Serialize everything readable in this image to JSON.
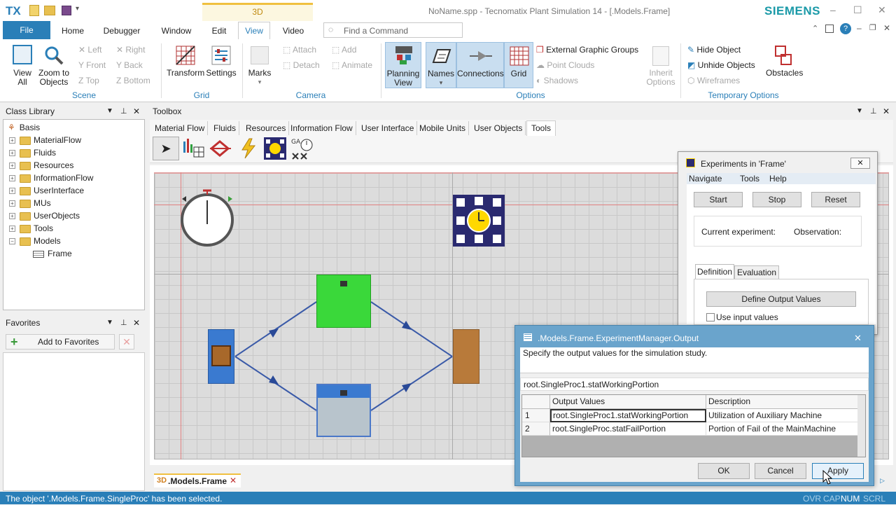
{
  "titlebar": {
    "logo": "TX",
    "context_tab": "3D",
    "title": "NoName.spp - Tecnomatix Plant Simulation 14 - [.Models.Frame]",
    "brand": "SIEMENS"
  },
  "ribbon_tabs": [
    "File",
    "Home",
    "Debugger",
    "Window",
    "Edit",
    "View",
    "Video"
  ],
  "active_tab": "View",
  "command_search": {
    "placeholder": "Find a Command"
  },
  "ribbon": {
    "scene": {
      "group": "Scene",
      "view_all_1": "View",
      "view_all_2": "All",
      "zoom_1": "Zoom to",
      "zoom_2": "Objects",
      "left": "Left",
      "right": "Right",
      "front": "Front",
      "back": "Back",
      "top": "Top",
      "bottom": "Bottom"
    },
    "grid": {
      "group": "Grid",
      "transform": "Transform",
      "settings": "Settings"
    },
    "camera": {
      "group": "Camera",
      "marks": "Marks",
      "attach": "Attach",
      "detach": "Detach",
      "add": "Add",
      "animate": "Animate"
    },
    "options": {
      "group": "Options",
      "planning_1": "Planning",
      "planning_2": "View",
      "names": "Names",
      "connections": "Connections",
      "grid": "Grid",
      "external": "External Graphic Groups",
      "point_clouds": "Point Clouds",
      "shadows": "Shadows",
      "inherit_1": "Inherit",
      "inherit_2": "Options"
    },
    "temporary": {
      "group": "Temporary Options",
      "hide": "Hide Object",
      "unhide": "Unhide Objects",
      "wireframes": "Wireframes",
      "obstacles": "Obstacles"
    }
  },
  "class_library": {
    "title": "Class Library",
    "root": "Basis",
    "items": [
      "MaterialFlow",
      "Fluids",
      "Resources",
      "InformationFlow",
      "UserInterface",
      "MUs",
      "UserObjects",
      "Tools",
      "Models"
    ],
    "frame": "Frame"
  },
  "favorites": {
    "title": "Favorites",
    "add_label": "Add to Favorites"
  },
  "toolbox": {
    "title": "Toolbox",
    "tabs": [
      "Material Flow",
      "Fluids",
      "Resources",
      "Information Flow",
      "User Interface",
      "Mobile Units",
      "User Objects",
      "Tools"
    ],
    "active": "Tools"
  },
  "doc_tab": {
    "badge": "3D",
    "label": ".Models.Frame"
  },
  "experiments": {
    "title": "Experiments in  'Frame'",
    "menu": [
      "Navigate",
      "Tools",
      "Help"
    ],
    "start": "Start",
    "stop": "Stop",
    "reset": "Reset",
    "current_experiment": "Current experiment:",
    "observation": "Observation:",
    "tab_definition": "Definition",
    "tab_evaluation": "Evaluation",
    "define_output": "Define Output Values",
    "use_input": "Use input values"
  },
  "output_dialog": {
    "title": ".Models.Frame.ExperimentManager.Output",
    "instruction": "Specify the output values for the simulation study.",
    "current_value": "root.SingleProc1.statWorkingPortion",
    "col_output": "Output Values",
    "col_description": "Description",
    "rows": [
      {
        "num": "1",
        "value": "root.SingleProc1.statWorkingPortion",
        "desc": "Utilization of Auxiliary Machine"
      },
      {
        "num": "2",
        "value": "root.SingleProc.statFailPortion",
        "desc": "Portion of Fail of the MainMachine"
      }
    ],
    "ok": "OK",
    "cancel": "Cancel",
    "apply": "Apply"
  },
  "statusbar": {
    "message": "The object '.Models.Frame.SingleProc' has been selected.",
    "ovr": "OVR",
    "cap": "CAP",
    "num": "NUM",
    "scrl": "SCRL"
  }
}
